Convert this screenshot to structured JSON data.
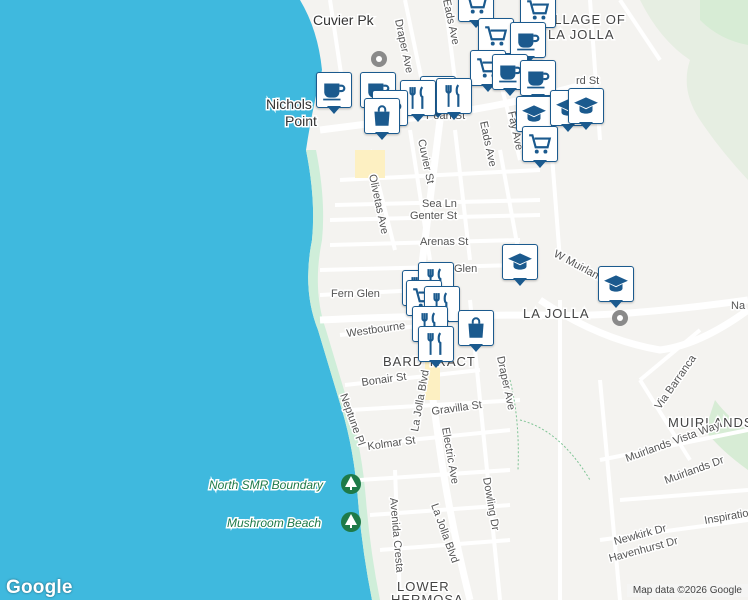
{
  "map": {
    "street_labels": {
      "pearl_st": "Pearl St",
      "cuvier_st": "Cuvier St",
      "olivetas_ave": "Olivetas Ave",
      "draper_ave_north": "Draper Ave",
      "eads_ave_north": "Eads Ave",
      "eads_ave": "Eads Ave",
      "fay_ave": "Fay Ave",
      "sea_ln": "Sea Ln",
      "genter_st": "Genter St",
      "arenas_st": "Arenas St",
      "glen": "Glen",
      "fern_glen": "Fern Glen",
      "westbourne": "Westbourne",
      "w_muirlands": "W Muirlands",
      "bonair_st": "Bonair St",
      "la_jolla_blvd_mid": "La Jolla Blvd",
      "gravilla_st": "Gravilla St",
      "draper_ave_south": "Draper Ave",
      "neptune_pl": "Neptune Pl",
      "kolmar_st": "Kolmar St",
      "electric_ave": "Electric Ave",
      "dowling_dr": "Dowling Dr",
      "avenida_cresta": "Avenida Cresta",
      "la_jolla_blvd_south": "La Jolla Blvd",
      "via_barranca": "Via Barranca",
      "muirlands_vista_way": "Muirlands Vista Way",
      "muirlands_dr": "Muirlands Dr",
      "newkirk_dr": "Newkirk Dr",
      "havenhurst_dr": "Havenhurst Dr",
      "inspiration": "Inspiration",
      "na": "Na",
      "rd_st": "rd St"
    },
    "area_labels": {
      "village": "VILLAGE OF",
      "la_jolla_top": "LA JOLLA",
      "la_jolla": "LA JOLLA",
      "bard_tract": "BARD TRACT",
      "muirlands": "MUIRLANDS",
      "lower": "LOWER",
      "hermosa": "HERMOSA"
    },
    "place_labels": {
      "cuvier_pk": "Cuvier Pk",
      "nichols": "Nichols",
      "point": "Point"
    },
    "poi_labels": {
      "north_smr_boundary": "North SMR Boundary",
      "mushroom_beach": "Mushroom Beach"
    },
    "markers": [
      {
        "icon": "shopping-cart-icon"
      },
      {
        "icon": "shopping-cart-icon"
      },
      {
        "icon": "shopping-cart-icon"
      },
      {
        "icon": "coffee-icon"
      },
      {
        "icon": "shopping-cart-icon"
      },
      {
        "icon": "coffee-icon"
      },
      {
        "icon": "coffee-icon"
      },
      {
        "icon": "coffee-icon"
      },
      {
        "icon": "coffee-icon"
      },
      {
        "icon": "coffee-icon"
      },
      {
        "icon": "restaurant-icon"
      },
      {
        "icon": "restaurant-icon"
      },
      {
        "icon": "coffee-icon"
      },
      {
        "icon": "shopping-bag-icon"
      },
      {
        "icon": "school-icon"
      },
      {
        "icon": "school-icon"
      },
      {
        "icon": "school-icon"
      },
      {
        "icon": "shopping-cart-icon"
      },
      {
        "icon": "school-icon"
      },
      {
        "icon": "school-icon"
      },
      {
        "icon": "restaurant-icon"
      },
      {
        "icon": "restaurant-icon"
      },
      {
        "icon": "shopping-cart-icon"
      },
      {
        "icon": "restaurant-icon"
      },
      {
        "icon": "restaurant-icon"
      },
      {
        "icon": "shopping-bag-icon"
      },
      {
        "icon": "restaurant-icon"
      }
    ],
    "attribution": "Map data ©2026 Google",
    "logo": "Google",
    "colors": {
      "water": "#3fb9de",
      "land": "#f4f3f0",
      "park": "#cfeed9",
      "marker_icon": "#1b5a8e",
      "poi_text": "#1e7a48"
    }
  }
}
